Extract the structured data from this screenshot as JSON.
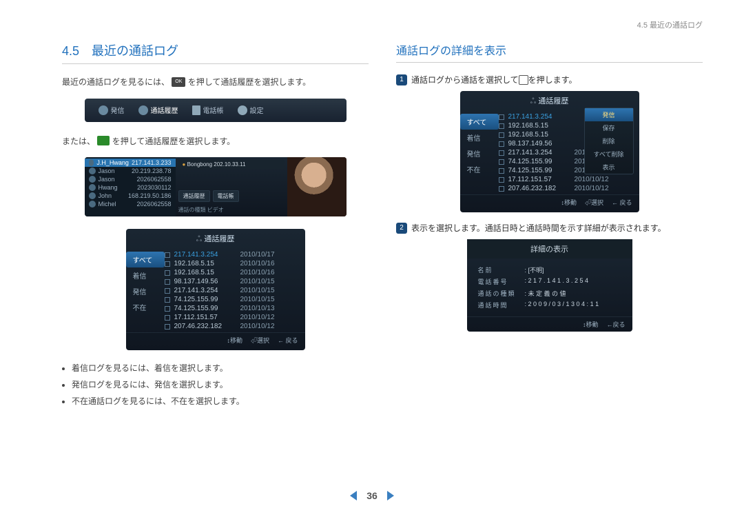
{
  "header": {
    "breadcrumb": "4.5 最近の通話ログ"
  },
  "left": {
    "title": "4.5　最近の通話ログ",
    "p1a": "最近の通話ログを見るには、",
    "p1b": "を押して通話履歴を選択します。",
    "ok_label": "OK",
    "topbar": {
      "call": "発信",
      "history": "通話履歴",
      "book": "電話帳",
      "settings": "設定"
    },
    "p2a": "または、",
    "p2b": "を押して通話履歴を選択します。",
    "contacts": {
      "header_name": "J.H_Hwang",
      "header_ip": "217.141.3.233",
      "rows": [
        {
          "name": "Jason",
          "ip": "20.219.238.78"
        },
        {
          "name": "Jason",
          "ip": "2026062558"
        },
        {
          "name": "Hwang",
          "ip": "2023030112"
        },
        {
          "name": "John",
          "ip": "168.219.50.186"
        },
        {
          "name": "Michel",
          "ip": "2026062558"
        }
      ],
      "bong": "Bongbong  202.10.33.11",
      "btn_history": "通話履歴",
      "btn_book": "電話帳",
      "sub": "通話の種類  ビデオ"
    },
    "log": {
      "title": "通話履歴",
      "tabs": [
        "すべて",
        "着信",
        "発信",
        "不在"
      ],
      "rows": [
        {
          "ip": "217.141.3.254",
          "date": "2010/10/17",
          "hl": true
        },
        {
          "ip": "192.168.5.15",
          "date": "2010/10/16"
        },
        {
          "ip": "192.168.5.15",
          "date": "2010/10/16"
        },
        {
          "ip": "98.137.149.56",
          "date": "2010/10/15"
        },
        {
          "ip": "217.141.3.254",
          "date": "2010/10/15"
        },
        {
          "ip": "74.125.155.99",
          "date": "2010/10/15"
        },
        {
          "ip": "74.125.155.99",
          "date": "2010/10/13"
        },
        {
          "ip": "17.112.151.57",
          "date": "2010/10/12"
        },
        {
          "ip": "207.46.232.182",
          "date": "2010/10/12"
        }
      ],
      "footer": {
        "move": "↕移動",
        "select": "⏎選択",
        "back": "← 戻る"
      }
    },
    "bullets": [
      "着信ログを見るには、着信を選択します。",
      "発信ログを見るには、発信を選択します。",
      "不在通話ログを見るには、不在を選択します。"
    ]
  },
  "right": {
    "title": "通話ログの詳細を表示",
    "step1a": "通話ログから通話を選択して",
    "step1b": "を押します。",
    "step1_badge": "1",
    "log": {
      "title": "通話履歴",
      "tabs": [
        "すべて",
        "着信",
        "発信",
        "不在"
      ],
      "rows": [
        {
          "ip": "217.141.3.254",
          "date": "",
          "hl": true
        },
        {
          "ip": "192.168.5.15",
          "date": ""
        },
        {
          "ip": "192.168.5.15",
          "date": ""
        },
        {
          "ip": "98.137.149.56",
          "date": ""
        },
        {
          "ip": "217.141.3.254",
          "date": "2010/10/15"
        },
        {
          "ip": "74.125.155.99",
          "date": "2010/10/15"
        },
        {
          "ip": "74.125.155.99",
          "date": "2010/10/13"
        },
        {
          "ip": "17.112.151.57",
          "date": "2010/10/12"
        },
        {
          "ip": "207.46.232.182",
          "date": "2010/10/12"
        }
      ],
      "menu": [
        "発信",
        "保存",
        "削除",
        "すべて削除",
        "表示"
      ],
      "footer": {
        "move": "↕移動",
        "select": "⏎選択",
        "back": "← 戻る"
      }
    },
    "step2_badge": "2",
    "step2": "表示を選択します。通話日時と通話時間を示す詳細が表示されます。",
    "detail": {
      "title": "詳細の表示",
      "rows": [
        {
          "label": "名前",
          "value": ": [不明]"
        },
        {
          "label": "電話番号",
          "value": ": 2 1 7 . 1 4 1 . 3 . 2 5 4"
        },
        {
          "label": "通話の種類",
          "value": ": 未 定 義 の 値"
        },
        {
          "label": "通話時間",
          "value": ": 2 0 0 9 / 0 3 / 1 3  0 4 : 1 1"
        }
      ],
      "footer": {
        "move": "↕移動",
        "back": "←戻る"
      }
    }
  },
  "pager": {
    "page": "36"
  }
}
